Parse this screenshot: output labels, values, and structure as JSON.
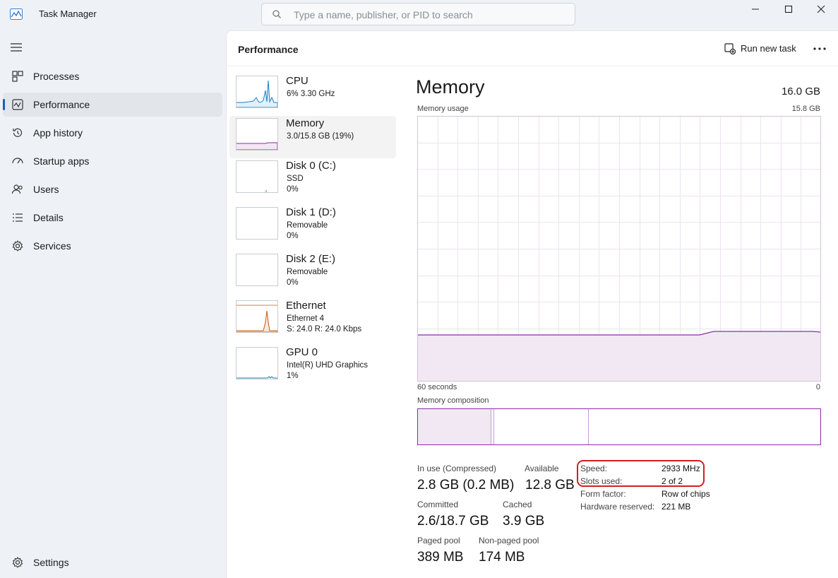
{
  "window": {
    "title": "Task Manager",
    "search_placeholder": "Type a name, publisher, or PID to search"
  },
  "sidebar": {
    "items": [
      {
        "label": "Processes",
        "icon": "processes-grid-icon"
      },
      {
        "label": "Performance",
        "icon": "performance-chart-icon",
        "active": true
      },
      {
        "label": "App history",
        "icon": "history-clock-icon"
      },
      {
        "label": "Startup apps",
        "icon": "startup-speedometer-icon"
      },
      {
        "label": "Users",
        "icon": "users-icon"
      },
      {
        "label": "Details",
        "icon": "details-list-icon"
      },
      {
        "label": "Services",
        "icon": "services-gear-icon"
      }
    ],
    "settings_label": "Settings"
  },
  "header": {
    "title": "Performance",
    "run_new_task": "Run new task"
  },
  "devices": [
    {
      "name": "CPU",
      "sub1": "6% 3.30 GHz",
      "sub2": ""
    },
    {
      "name": "Memory",
      "sub1": "3.0/15.8 GB (19%)",
      "sub2": "",
      "active": true
    },
    {
      "name": "Disk 0 (C:)",
      "sub1": "SSD",
      "sub2": "0%"
    },
    {
      "name": "Disk 1 (D:)",
      "sub1": "Removable",
      "sub2": "0%"
    },
    {
      "name": "Disk 2 (E:)",
      "sub1": "Removable",
      "sub2": "0%"
    },
    {
      "name": "Ethernet",
      "sub1": "Ethernet 4",
      "sub2": "S: 24.0  R: 24.0 Kbps"
    },
    {
      "name": "GPU 0",
      "sub1": "Intel(R) UHD Graphics",
      "sub2": "1%"
    }
  ],
  "memory": {
    "title": "Memory",
    "total": "16.0 GB",
    "usage_label": "Memory usage",
    "usage_max": "15.8 GB",
    "axis_left": "60 seconds",
    "axis_right": "0",
    "composition_label": "Memory composition",
    "composition_fractions": {
      "in_use": 0.182,
      "modified": 0.005,
      "standby": 0.234,
      "free": 0.579
    },
    "usage_fraction": 0.19,
    "stats": {
      "in_use_label": "In use (Compressed)",
      "in_use_value": "2.8 GB (0.2 MB)",
      "available_label": "Available",
      "available_value": "12.8 GB",
      "committed_label": "Committed",
      "committed_value": "2.6/18.7 GB",
      "cached_label": "Cached",
      "cached_value": "3.9 GB",
      "paged_label": "Paged pool",
      "paged_value": "389 MB",
      "nonpaged_label": "Non-paged pool",
      "nonpaged_value": "174 MB"
    },
    "details": [
      {
        "label": "Speed:",
        "value": "2933 MHz"
      },
      {
        "label": "Slots used:",
        "value": "2 of 2"
      },
      {
        "label": "Form factor:",
        "value": "Row of chips"
      },
      {
        "label": "Hardware reserved:",
        "value": "221 MB"
      }
    ]
  },
  "colors": {
    "memory_accent": "#8b2ca6",
    "cpu_accent": "#1f7fc1",
    "ethernet_accent": "#c35b12",
    "highlight": "#d21f1f"
  }
}
